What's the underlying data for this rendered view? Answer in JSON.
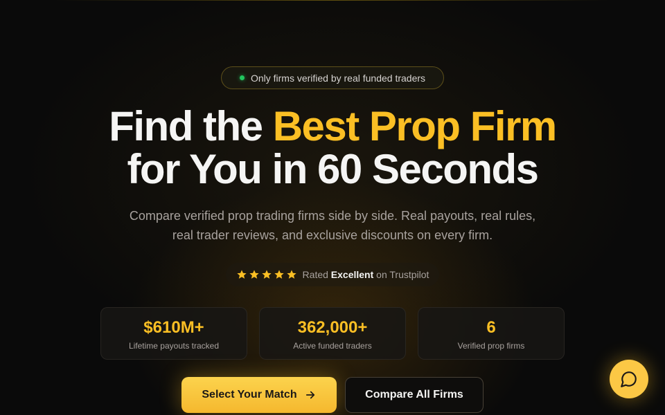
{
  "badge": {
    "text": "Only firms verified by real funded traders"
  },
  "hero": {
    "line1_pre": "Find the ",
    "line1_accent": "Best Prop Firm",
    "line2": "for You in 60 Seconds",
    "subtitle": "Compare verified prop trading firms side by side. Real payouts, real rules, real trader reviews, and exclusive discounts on every firm."
  },
  "rating": {
    "stars": 5,
    "prefix": "Rated ",
    "strong": "Excellent",
    "suffix": " on Trustpilot"
  },
  "stats": [
    {
      "value": "$610M+",
      "label": "Lifetime payouts tracked"
    },
    {
      "value": "362,000+",
      "label": "Active funded traders"
    },
    {
      "value": "6",
      "label": "Verified prop firms"
    }
  ],
  "cta": {
    "primary_label": "Select Your Match",
    "secondary_label": "Compare All Firms"
  },
  "icons": {
    "badge_dot": "status-dot",
    "star": "star-icon",
    "arrow": "arrow-right-icon",
    "chat": "chat-bubble-icon"
  },
  "colors": {
    "accent": "#fbbf24",
    "background": "#0a0a0a",
    "status_green": "#22c55e"
  }
}
